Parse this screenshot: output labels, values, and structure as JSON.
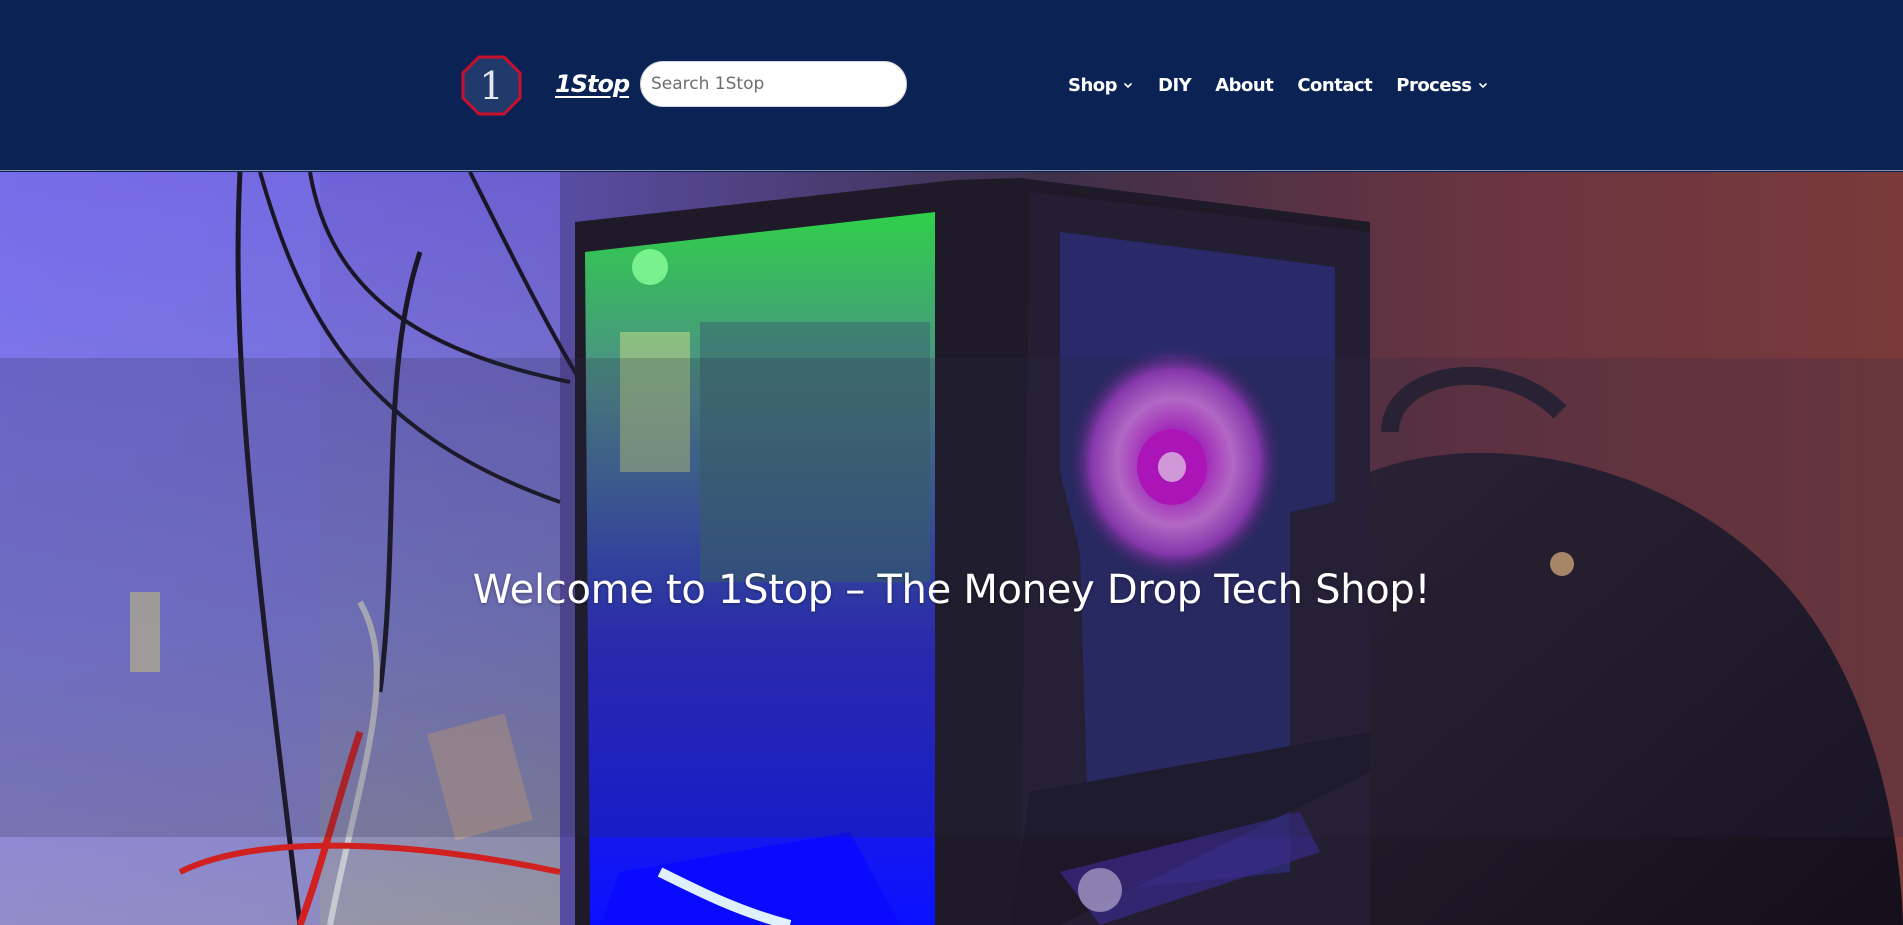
{
  "header": {
    "logo_glyph": "1",
    "site_title": "1Stop",
    "search": {
      "placeholder": "Search 1Stop",
      "value": ""
    },
    "nav": [
      {
        "label": "Shop",
        "has_dropdown": true
      },
      {
        "label": "DIY",
        "has_dropdown": false
      },
      {
        "label": "About",
        "has_dropdown": false
      },
      {
        "label": "Contact",
        "has_dropdown": false
      },
      {
        "label": "Process",
        "has_dropdown": true
      }
    ]
  },
  "hero": {
    "title": "Welcome to 1Stop – The Money Drop Tech Shop!"
  },
  "colors": {
    "header_bg": "#0a2254",
    "logo_border": "#c8102e",
    "logo_fill": "#1f3a6b",
    "text": "#ffffff"
  },
  "icons": {
    "logo": "octagon-1-logo-icon",
    "dropdown": "chevron-down-icon"
  }
}
